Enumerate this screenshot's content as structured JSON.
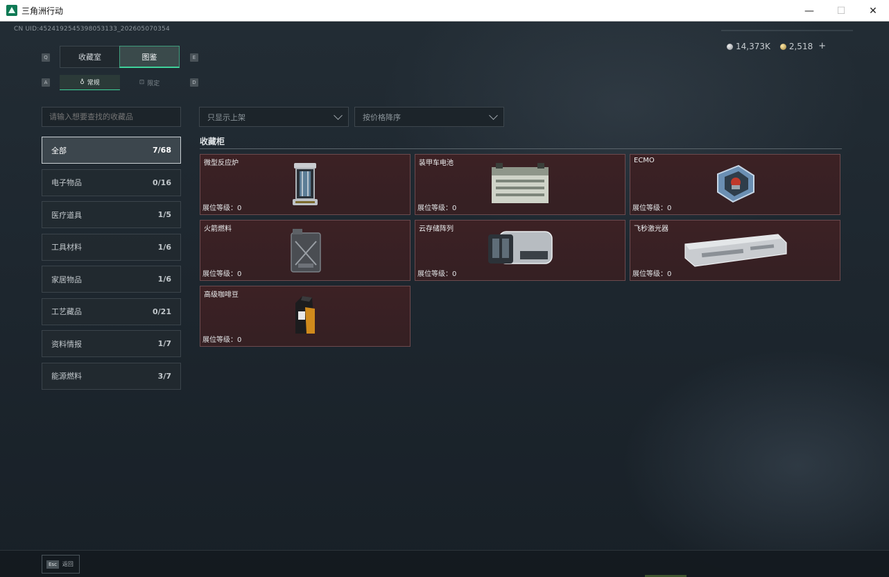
{
  "window": {
    "title": "三角洲行动",
    "minimize": "—",
    "maximize": "☐",
    "close": "✕"
  },
  "uid": "CN UID:4524192545398053133_202605070354",
  "currency": {
    "coins": "14,373K",
    "tickets": "2,518",
    "plus": "+"
  },
  "key_hints": {
    "tab_prev": "Q",
    "tab_next": "E",
    "sub_prev": "A",
    "sub_next": "D"
  },
  "tabs": [
    {
      "label": "收藏室",
      "active": false
    },
    {
      "label": "图鉴",
      "active": true
    }
  ],
  "sub_tabs": [
    {
      "label": "常规",
      "icon": "flame-icon",
      "active": true
    },
    {
      "label": "限定",
      "icon": "gift-icon",
      "active": false
    }
  ],
  "search": {
    "placeholder": "请输入想要查找的收藏品"
  },
  "filters": {
    "shelf_filter": "只显示上架",
    "sort": "按价格降序"
  },
  "categories": [
    {
      "label": "全部",
      "count": "7/68",
      "active": true
    },
    {
      "label": "电子物品",
      "count": "0/16",
      "active": false
    },
    {
      "label": "医疗道具",
      "count": "1/5",
      "active": false
    },
    {
      "label": "工具材料",
      "count": "1/6",
      "active": false
    },
    {
      "label": "家居物品",
      "count": "1/6",
      "active": false
    },
    {
      "label": "工艺藏品",
      "count": "0/21",
      "active": false
    },
    {
      "label": "资料情报",
      "count": "1/7",
      "active": false
    },
    {
      "label": "能源燃料",
      "count": "3/7",
      "active": false
    }
  ],
  "section_title": "收藏柜",
  "items": [
    {
      "name": "微型反应炉",
      "level": "展位等级：0",
      "icon": "reactor-icon"
    },
    {
      "name": "装甲车电池",
      "level": "展位等级：0",
      "icon": "battery-icon"
    },
    {
      "name": "ECMO",
      "level": "展位等级：0",
      "icon": "ecmo-icon"
    },
    {
      "name": "火箭燃料",
      "level": "展位等级：0",
      "icon": "fuel-canister-icon"
    },
    {
      "name": "云存储阵列",
      "level": "展位等级：0",
      "icon": "storage-array-icon"
    },
    {
      "name": "飞秒激光器",
      "level": "展位等级：0",
      "icon": "laser-icon"
    },
    {
      "name": "高级咖啡豆",
      "level": "展位等级：0",
      "icon": "coffee-bag-icon"
    }
  ],
  "footer": {
    "esc_key": "Esc",
    "esc_label": "返回"
  }
}
